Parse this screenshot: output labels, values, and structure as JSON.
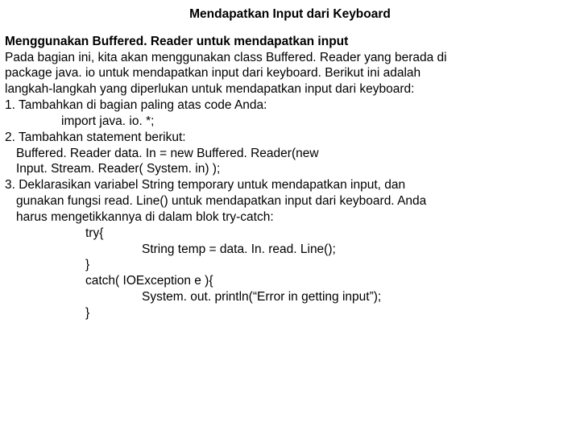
{
  "title": "Mendapatkan Input dari Keyboard",
  "subtitle": "Menggunakan Buffered. Reader untuk mendapatkan input",
  "p1": "Pada bagian ini, kita akan menggunakan class Buffered. Reader yang berada di",
  "p2": "package java. io untuk mendapatkan input dari keyboard. Berikut ini adalah",
  "p3": "langkah-langkah yang diperlukan untuk mendapatkan input dari keyboard:",
  "l1": "1. Tambahkan di bagian paling atas code Anda:",
  "l1c": "import java. io. *;",
  "l2": "2. Tambahkan statement berikut:",
  "l2c1": "Buffered. Reader data. In = new Buffered. Reader(new",
  "l2c2": "Input. Stream. Reader( System. in) );",
  "l3a": "3. Deklarasikan variabel String temporary untuk mendapatkan input, dan",
  "l3b": "gunakan fungsi read. Line() untuk mendapatkan input dari keyboard. Anda",
  "l3c": "harus mengetikkannya di dalam blok try-catch:",
  "c1": "try{",
  "c2": "String temp = data. In. read. Line();",
  "c3": "}",
  "c4": "catch( IOException e ){",
  "c5": "System. out. println(“Error in getting input”);",
  "c6": "}"
}
